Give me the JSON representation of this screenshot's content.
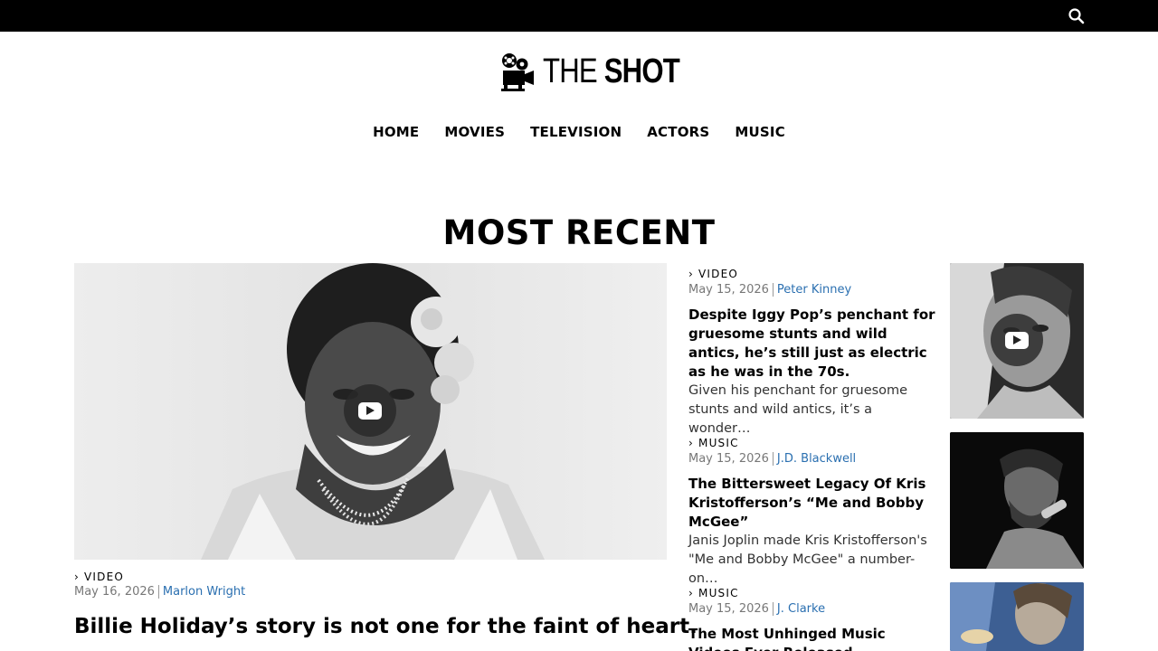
{
  "site": {
    "logo_text_light": "THE ",
    "logo_text_bold": "SHOT"
  },
  "nav": [
    {
      "label": "HOME"
    },
    {
      "label": "MOVIES"
    },
    {
      "label": "TELEVISION"
    },
    {
      "label": "ACTORS"
    },
    {
      "label": "MUSIC"
    }
  ],
  "section_title": "MOST RECENT",
  "feature": {
    "category": "› VIDEO",
    "date": "May 16, 2026",
    "author": "Marlon Wright",
    "headline": "Billie Holiday’s story is not one for the faint of heart."
  },
  "articles": [
    {
      "category": "› VIDEO",
      "date": "May 15, 2026",
      "author": "Peter Kinney",
      "headline": "Despite Iggy Pop’s penchant for gruesome stunts and wild antics, he’s still just as electric as he was in the 70s.",
      "excerpt": "Given his penchant for gruesome stunts and wild antics, it’s a wonder…"
    },
    {
      "category": "› MUSIC",
      "date": "May 15, 2026",
      "author": "J.D. Blackwell",
      "headline": "The Bittersweet Legacy Of Kris Kristofferson’s “Me and Bobby McGee”",
      "excerpt": "Janis Joplin made Kris Kristofferson's \"Me and Bobby McGee\" a number-on…"
    },
    {
      "category": "› MUSIC",
      "date": "May 15, 2026",
      "author": "J. Clarke",
      "headline": "The Most Unhinged Music Videos Ever Released",
      "excerpt": ""
    }
  ],
  "icons": {
    "search": "search-icon",
    "logo": "film-camera-icon",
    "play": "play-icon"
  },
  "colors": {
    "topbar": "#000000",
    "author_link": "#2a6fb0",
    "meta_text": "#777777"
  }
}
